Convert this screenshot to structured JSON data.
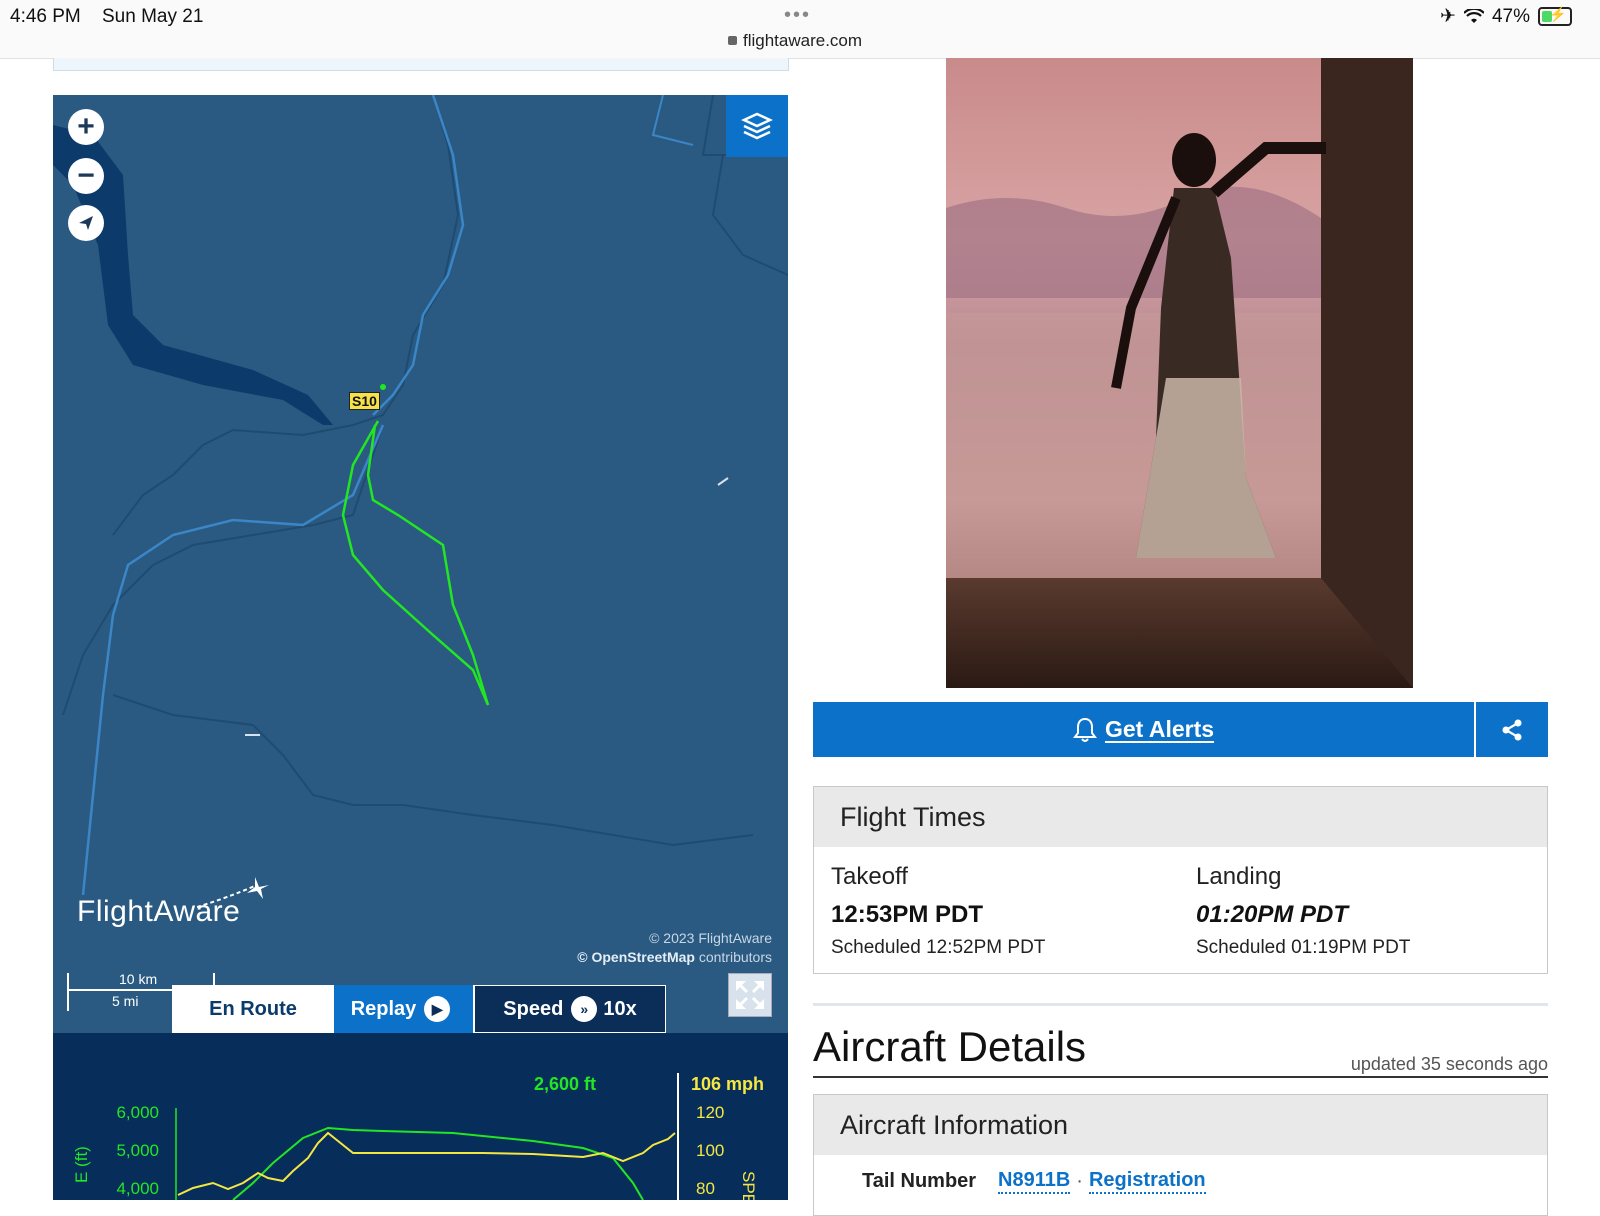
{
  "status_bar": {
    "time": "4:46 PM",
    "date": "Sun May 21",
    "battery": "47%",
    "battery_level": 0.47,
    "url": "flightaware.com",
    "dots": "•••"
  },
  "map": {
    "zoom_in": "+",
    "zoom_out": "−",
    "aircraft_label": "S10",
    "logo_text": "FlightAware",
    "copyright_line1": "© 2023 FlightAware",
    "copyright_osm": "© OpenStreetMap",
    "copyright_contrib": " contributors",
    "scale_km": "10 km",
    "scale_mi": "5 mi"
  },
  "tabs": {
    "en_route": "En Route",
    "replay": "Replay",
    "speed": "Speed",
    "speed_value": "10x"
  },
  "profile": {
    "altitude_now": "2,600 ft",
    "speed_now": "106 mph",
    "alt_ticks": [
      "6,000",
      "5,000",
      "4,000"
    ],
    "speed_ticks": [
      "120",
      "100",
      "80"
    ],
    "alt_axis_label": "E (ft)",
    "speed_axis_label": "SPE"
  },
  "alerts": {
    "label": "Get Alerts"
  },
  "flight_times": {
    "title": "Flight Times",
    "takeoff_label": "Takeoff",
    "takeoff_time": "12:53PM PDT",
    "takeoff_scheduled": "Scheduled 12:52PM PDT",
    "landing_label": "Landing",
    "landing_time": "01:20PM PDT",
    "landing_scheduled": "Scheduled 01:19PM PDT"
  },
  "aircraft_details": {
    "title": "Aircraft Details",
    "updated": "updated 35 seconds ago",
    "info_title": "Aircraft Information",
    "tail_number_label": "Tail Number",
    "tail_number": "N8911B",
    "registration_link": "Registration",
    "separator": "·"
  },
  "colors": {
    "brand_blue": "#0c72c9",
    "map_water": "#2a5a82",
    "track_green": "#22e622",
    "profile_bg": "#072d5b"
  }
}
